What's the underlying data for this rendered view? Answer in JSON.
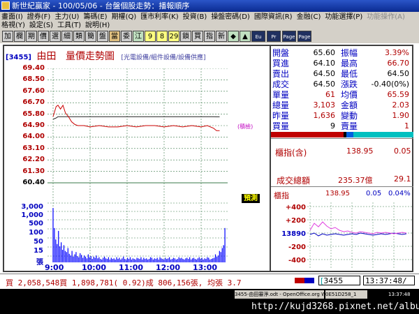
{
  "window": {
    "title": "新世紀贏家 - 100/05/06 - 台盤個股走勢：播報順序"
  },
  "menu": {
    "row1": [
      "畫面(I)",
      "證券(F)",
      "主力(U)",
      "籌碼(E)",
      "期權(Q)",
      "匯市利率(K)",
      "投資(B)",
      "操盤密碼(D)",
      "國際資訊(R)",
      "金融(C)",
      "功能選擇(P)"
    ],
    "row1_dim": [
      "功能操作(A)"
    ],
    "row2": [
      "格視(Y)",
      "設定(S)",
      "工具(T)",
      "說明(H)"
    ]
  },
  "toolbar": {
    "buttons": [
      "加",
      "欄",
      "期",
      "價",
      "選",
      "細",
      "類",
      "簡",
      "盤",
      "當",
      "委",
      "江",
      "9",
      "8",
      "29",
      "鎖",
      "買",
      "指",
      "新",
      "◆",
      "▲",
      "Eu",
      "Pr",
      "Page",
      "Page"
    ]
  },
  "stock": {
    "code": "[3455]",
    "name": "由田",
    "chart_title": "量價走勢圖",
    "sector": "[光電設備/組件設備/設備供應]"
  },
  "chart_data": {
    "type": "line",
    "price_axis": {
      "labels": [
        "69.40",
        "68.50",
        "67.60",
        "66.70",
        "65.80",
        "64.90",
        "64.00",
        "63.10",
        "62.20",
        "61.30",
        "60.40"
      ],
      "reference": "64.90",
      "ylim": [
        60.4,
        69.4
      ]
    },
    "volume_axis": {
      "labels": [
        "3,000",
        "1,000",
        "500",
        "100",
        "50",
        "15",
        "張"
      ]
    },
    "x_ticks": [
      "9:00",
      "10:00",
      "11:00",
      "12:00",
      "13:00"
    ],
    "price_series": {
      "name": "成交價",
      "x": [
        "9:00",
        "9:05",
        "9:08",
        "9:12",
        "9:16",
        "9:20",
        "9:25",
        "9:30",
        "9:35",
        "9:40",
        "9:50",
        "10:00",
        "10:15",
        "10:30",
        "10:45",
        "11:00",
        "11:15",
        "11:30",
        "11:45",
        "12:00",
        "12:15",
        "12:30",
        "12:45",
        "13:00",
        "13:10",
        "13:20",
        "13:25",
        "13:30"
      ],
      "values": [
        65.6,
        66.4,
        66.5,
        66.2,
        66.5,
        65.9,
        65.6,
        65.2,
        65.0,
        64.9,
        64.9,
        64.8,
        64.9,
        64.8,
        64.8,
        64.9,
        64.8,
        64.9,
        64.9,
        64.8,
        64.9,
        64.8,
        64.9,
        64.8,
        64.9,
        64.7,
        64.5,
        64.5
      ]
    },
    "avg_series": {
      "name": "均價",
      "values": [
        65.4,
        65.5,
        65.6,
        65.6,
        65.6,
        65.6,
        65.6,
        65.6,
        65.6,
        65.6,
        65.6,
        65.6,
        65.6,
        65.6,
        65.6,
        65.6,
        65.6,
        65.6,
        65.6,
        65.6,
        65.6,
        65.6,
        65.6,
        65.6,
        65.6,
        65.6,
        65.59,
        65.59
      ]
    },
    "volume_bars": [
      95,
      60,
      40,
      32,
      55,
      28,
      35,
      22,
      30,
      20,
      18,
      25,
      15,
      12,
      20,
      10,
      14,
      18,
      11,
      9,
      16,
      13,
      8,
      12,
      10,
      7,
      14,
      9,
      11,
      6,
      10,
      8,
      12,
      7,
      9,
      6,
      5,
      8,
      10,
      7,
      6,
      9,
      5,
      8,
      6,
      7,
      5,
      9,
      6,
      8,
      5,
      7,
      10,
      6,
      5,
      8,
      6,
      9,
      5,
      7,
      6,
      5,
      8,
      7,
      6,
      9,
      5,
      8,
      6,
      7,
      5,
      6,
      9,
      8,
      5,
      7,
      6,
      8,
      5,
      9,
      7,
      6,
      5,
      8,
      6,
      7,
      9,
      5,
      6,
      8,
      7,
      5,
      6,
      9,
      7,
      8,
      6,
      5,
      7,
      8,
      6,
      9,
      5,
      7,
      8,
      6,
      5,
      7,
      9,
      6,
      8,
      5,
      7,
      6,
      9,
      8,
      5,
      6,
      7,
      8,
      14,
      10,
      12,
      20,
      18,
      25,
      30,
      60
    ],
    "marker_label": "(積檢)"
  },
  "notice": "預測",
  "quote": {
    "rows": [
      {
        "l1": "開盤",
        "v1": "65.60",
        "l2": "振幅",
        "v2": "3.39%"
      },
      {
        "l1": "買進",
        "v1": "64.10",
        "l2": "最高",
        "v2": "66.70"
      },
      {
        "l1": "賣出",
        "v1": "64.50",
        "l2": "最低",
        "v2": "64.50"
      },
      {
        "l1": "成交",
        "v1": "64.50",
        "l2": "漲跌",
        "v2": "-0.40(0%)"
      },
      {
        "l1": "單量",
        "v1": "61",
        "l2": "均價",
        "v2": "65.59"
      },
      {
        "l1": "總量",
        "v1": "3,103",
        "l2": "金額",
        "v2": "2.03"
      },
      {
        "l1": "昨量",
        "v1": "1,636",
        "l2": "變動",
        "v2": "1.90"
      },
      {
        "l1": "買量",
        "v1": "9",
        "l2": "賣量",
        "v2": "1"
      }
    ]
  },
  "index_box": {
    "label": "櫃指(含)",
    "value": "138.95",
    "change": "0.05",
    "turnover_label": "成交總額",
    "turnover": "235.37億",
    "turnover_change": "29.1"
  },
  "otc": {
    "label": "櫃指",
    "value": "138.95",
    "pts": "0.05",
    "pct": "0.04%",
    "y_labels": [
      "+400",
      "+200",
      "13890",
      "-200",
      "-400"
    ]
  },
  "status": {
    "text": "買 2,058,548買 1,898,781( 0.92)成 806,156張, 均張 3.7",
    "code_input": "3455",
    "clock": "13:37:48/"
  },
  "taskbar": {
    "item1": "3455-由田審淨.odt - OpenOffice.org Writer",
    "item2": "0E51D258_1",
    "time": "13:37:48",
    "watermark": "http://kujd3268.pixnet.net/album"
  },
  "colors": {
    "price_line": "#cc0000",
    "avg_line": "#202020",
    "volume": "#0000ff",
    "grid": "#3a7a4a",
    "otc_index": "#0000c0",
    "otc_pink": "#e040e0"
  }
}
